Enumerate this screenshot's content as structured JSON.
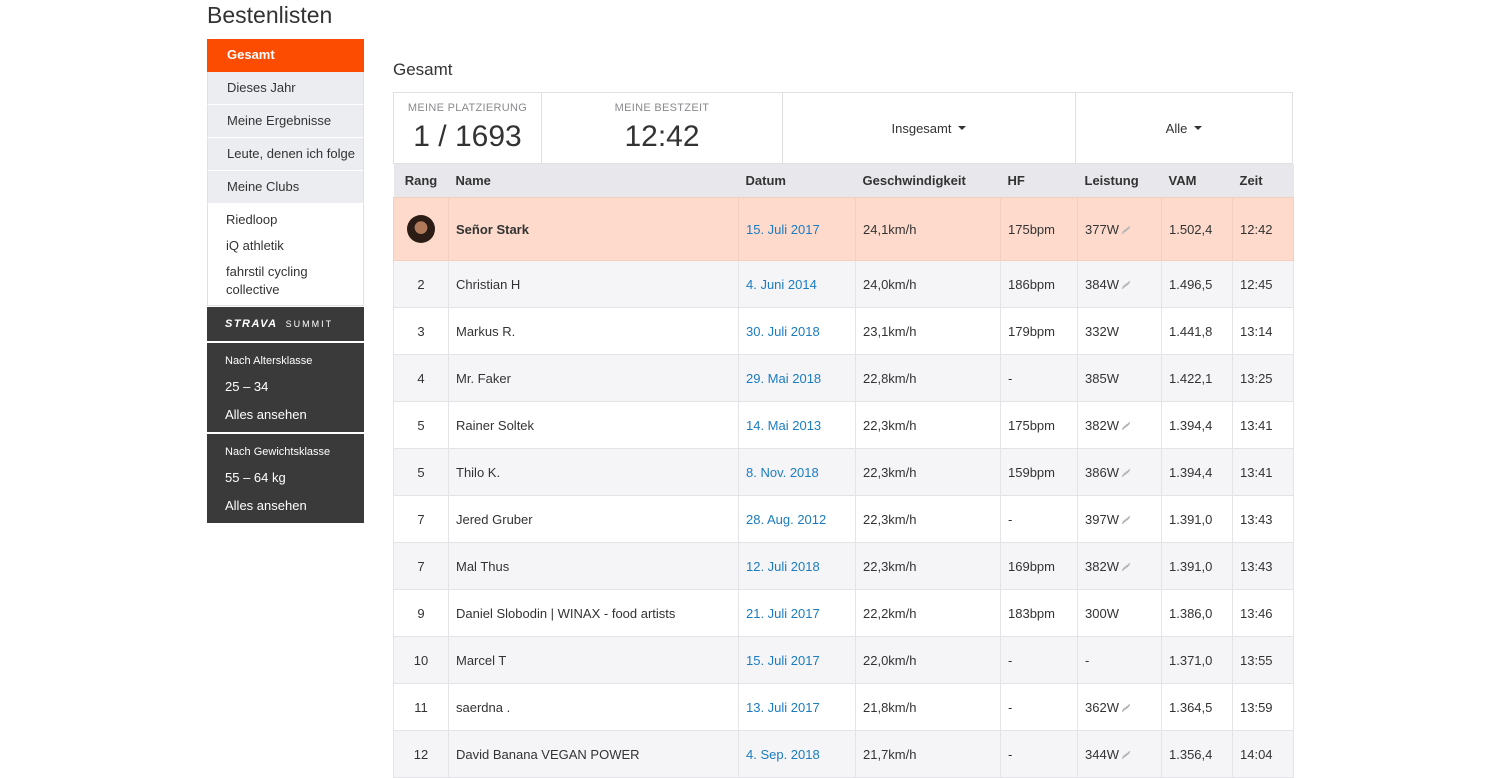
{
  "page_title": "Bestenlisten",
  "sidebar": {
    "nav": [
      "Gesamt",
      "Dieses Jahr",
      "Meine Ergebnisse",
      "Leute, denen ich folge",
      "Meine Clubs"
    ],
    "clubs": [
      "Riedloop",
      "iQ athletik",
      "fahrstil cycling collective"
    ],
    "summit": {
      "logo": "STRAVA",
      "tag": "SUMMIT"
    },
    "age": {
      "label": "Nach Altersklasse",
      "value": "25 – 34",
      "link": "Alles ansehen"
    },
    "weight": {
      "label": "Nach Gewichtsklasse",
      "value": "55 – 64 kg",
      "link": "Alles ansehen"
    }
  },
  "main": {
    "section_title": "Gesamt",
    "stats": {
      "placement_label": "MEINE PLATZIERUNG",
      "placement_value": "1 / 1693",
      "best_label": "MEINE BESTZEIT",
      "best_value": "12:42",
      "filter1": "Insgesamt",
      "filter2": "Alle"
    },
    "columns": [
      "Rang",
      "Name",
      "Datum",
      "Geschwindigkeit",
      "HF",
      "Leistung",
      "VAM",
      "Zeit"
    ],
    "rows": [
      {
        "rank": "",
        "name": "Señor Stark",
        "date": "15. Juli 2017",
        "speed": "24,1km/h",
        "hr": "175bpm",
        "power": "377W",
        "vam": "1.502,4",
        "time": "12:42"
      },
      {
        "rank": "2",
        "name": "Christian H",
        "date": "4. Juni 2014",
        "speed": "24,0km/h",
        "hr": "186bpm",
        "power": "384W",
        "vam": "1.496,5",
        "time": "12:45"
      },
      {
        "rank": "3",
        "name": "Markus R.",
        "date": "30. Juli 2018",
        "speed": "23,1km/h",
        "hr": "179bpm",
        "power": "332W",
        "vam": "1.441,8",
        "time": "13:14"
      },
      {
        "rank": "4",
        "name": "Mr. Faker",
        "date": "29. Mai 2018",
        "speed": "22,8km/h",
        "hr": "-",
        "power": "385W",
        "vam": "1.422,1",
        "time": "13:25"
      },
      {
        "rank": "5",
        "name": "Rainer Soltek",
        "date": "14. Mai 2013",
        "speed": "22,3km/h",
        "hr": "175bpm",
        "power": "382W",
        "vam": "1.394,4",
        "time": "13:41"
      },
      {
        "rank": "5",
        "name": "Thilo K.",
        "date": "8. Nov. 2018",
        "speed": "22,3km/h",
        "hr": "159bpm",
        "power": "386W",
        "vam": "1.394,4",
        "time": "13:41"
      },
      {
        "rank": "7",
        "name": "Jered Gruber",
        "date": "28. Aug. 2012",
        "speed": "22,3km/h",
        "hr": "-",
        "power": "397W",
        "vam": "1.391,0",
        "time": "13:43"
      },
      {
        "rank": "7",
        "name": "Mal Thus",
        "date": "12. Juli 2018",
        "speed": "22,3km/h",
        "hr": "169bpm",
        "power": "382W",
        "vam": "1.391,0",
        "time": "13:43"
      },
      {
        "rank": "9",
        "name": "Daniel Slobodin | WINAX - food artists",
        "date": "21. Juli 2017",
        "speed": "22,2km/h",
        "hr": "183bpm",
        "power": "300W",
        "vam": "1.386,0",
        "time": "13:46"
      },
      {
        "rank": "10",
        "name": "Marcel T",
        "date": "15. Juli 2017",
        "speed": "22,0km/h",
        "hr": "-",
        "power": "-",
        "vam": "1.371,0",
        "time": "13:55"
      },
      {
        "rank": "11",
        "name": "saerdna .",
        "date": "13. Juli 2017",
        "speed": "21,8km/h",
        "hr": "-",
        "power": "362W",
        "vam": "1.364,5",
        "time": "13:59"
      },
      {
        "rank": "12",
        "name": "David Banana VEGAN POWER",
        "date": "4. Sep. 2018",
        "speed": "21,7km/h",
        "hr": "-",
        "power": "344W",
        "vam": "1.356,4",
        "time": "14:04"
      }
    ]
  },
  "colors": {
    "accent": "#fc4c02",
    "highlight_row": "#fddacc",
    "link": "#1b7cc1",
    "dark_panel": "#3a3a3a"
  }
}
